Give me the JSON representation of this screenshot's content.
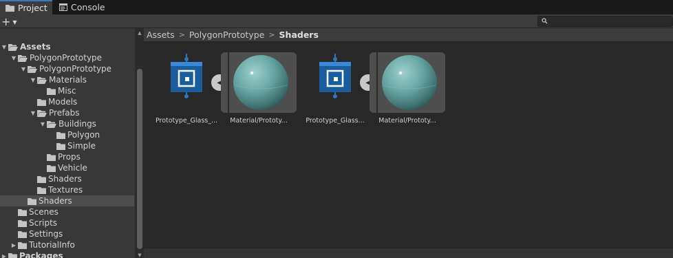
{
  "tabs": [
    {
      "label": "Project",
      "icon": "folder-icon",
      "active": true
    },
    {
      "label": "Console",
      "icon": "console-icon",
      "active": false
    }
  ],
  "toolbar": {
    "create_label": "+",
    "search_placeholder": ""
  },
  "tree": {
    "items": [
      {
        "label": "Assets",
        "depth": 0,
        "expanded": true,
        "bold": true
      },
      {
        "label": "PolygonPrototype",
        "depth": 1,
        "expanded": true
      },
      {
        "label": "PolygonPrototype",
        "depth": 2,
        "expanded": true
      },
      {
        "label": "Materials",
        "depth": 3,
        "expanded": true
      },
      {
        "label": "Misc",
        "depth": 4
      },
      {
        "label": "Models",
        "depth": 3
      },
      {
        "label": "Prefabs",
        "depth": 3,
        "expanded": true
      },
      {
        "label": "Buildings",
        "depth": 4,
        "expanded": true
      },
      {
        "label": "Polygon",
        "depth": 5
      },
      {
        "label": "Simple",
        "depth": 5
      },
      {
        "label": "Props",
        "depth": 4
      },
      {
        "label": "Vehicle",
        "depth": 4
      },
      {
        "label": "Shaders",
        "depth": 3
      },
      {
        "label": "Textures",
        "depth": 3
      },
      {
        "label": "Shaders",
        "depth": 2,
        "selected": true
      },
      {
        "label": "Scenes",
        "depth": 1
      },
      {
        "label": "Scripts",
        "depth": 1
      },
      {
        "label": "Settings",
        "depth": 1
      },
      {
        "label": "TutorialInfo",
        "depth": 1,
        "collapsed": true
      },
      {
        "label": "Packages",
        "depth": 0,
        "collapsed": true,
        "bold": true
      }
    ]
  },
  "breadcrumb": {
    "items": [
      "Assets",
      "PolygonPrototype"
    ],
    "current": "Shaders"
  },
  "assets": [
    {
      "label": "Prototype_Glass_...",
      "kind": "shader-graph",
      "icon": "shader-graph-icon"
    },
    {
      "label": "Material/Prototy...",
      "kind": "material",
      "icon": "material-sphere-icon"
    },
    {
      "label": "Prototype_Glass...",
      "kind": "shader-graph",
      "icon": "shader-graph-icon"
    },
    {
      "label": "Material/Prototy...",
      "kind": "material",
      "icon": "material-sphere-icon"
    }
  ],
  "colors": {
    "accent": "#3a79bb",
    "shader_blue": "#1b5d9c",
    "selection": "#4d4d4d"
  }
}
